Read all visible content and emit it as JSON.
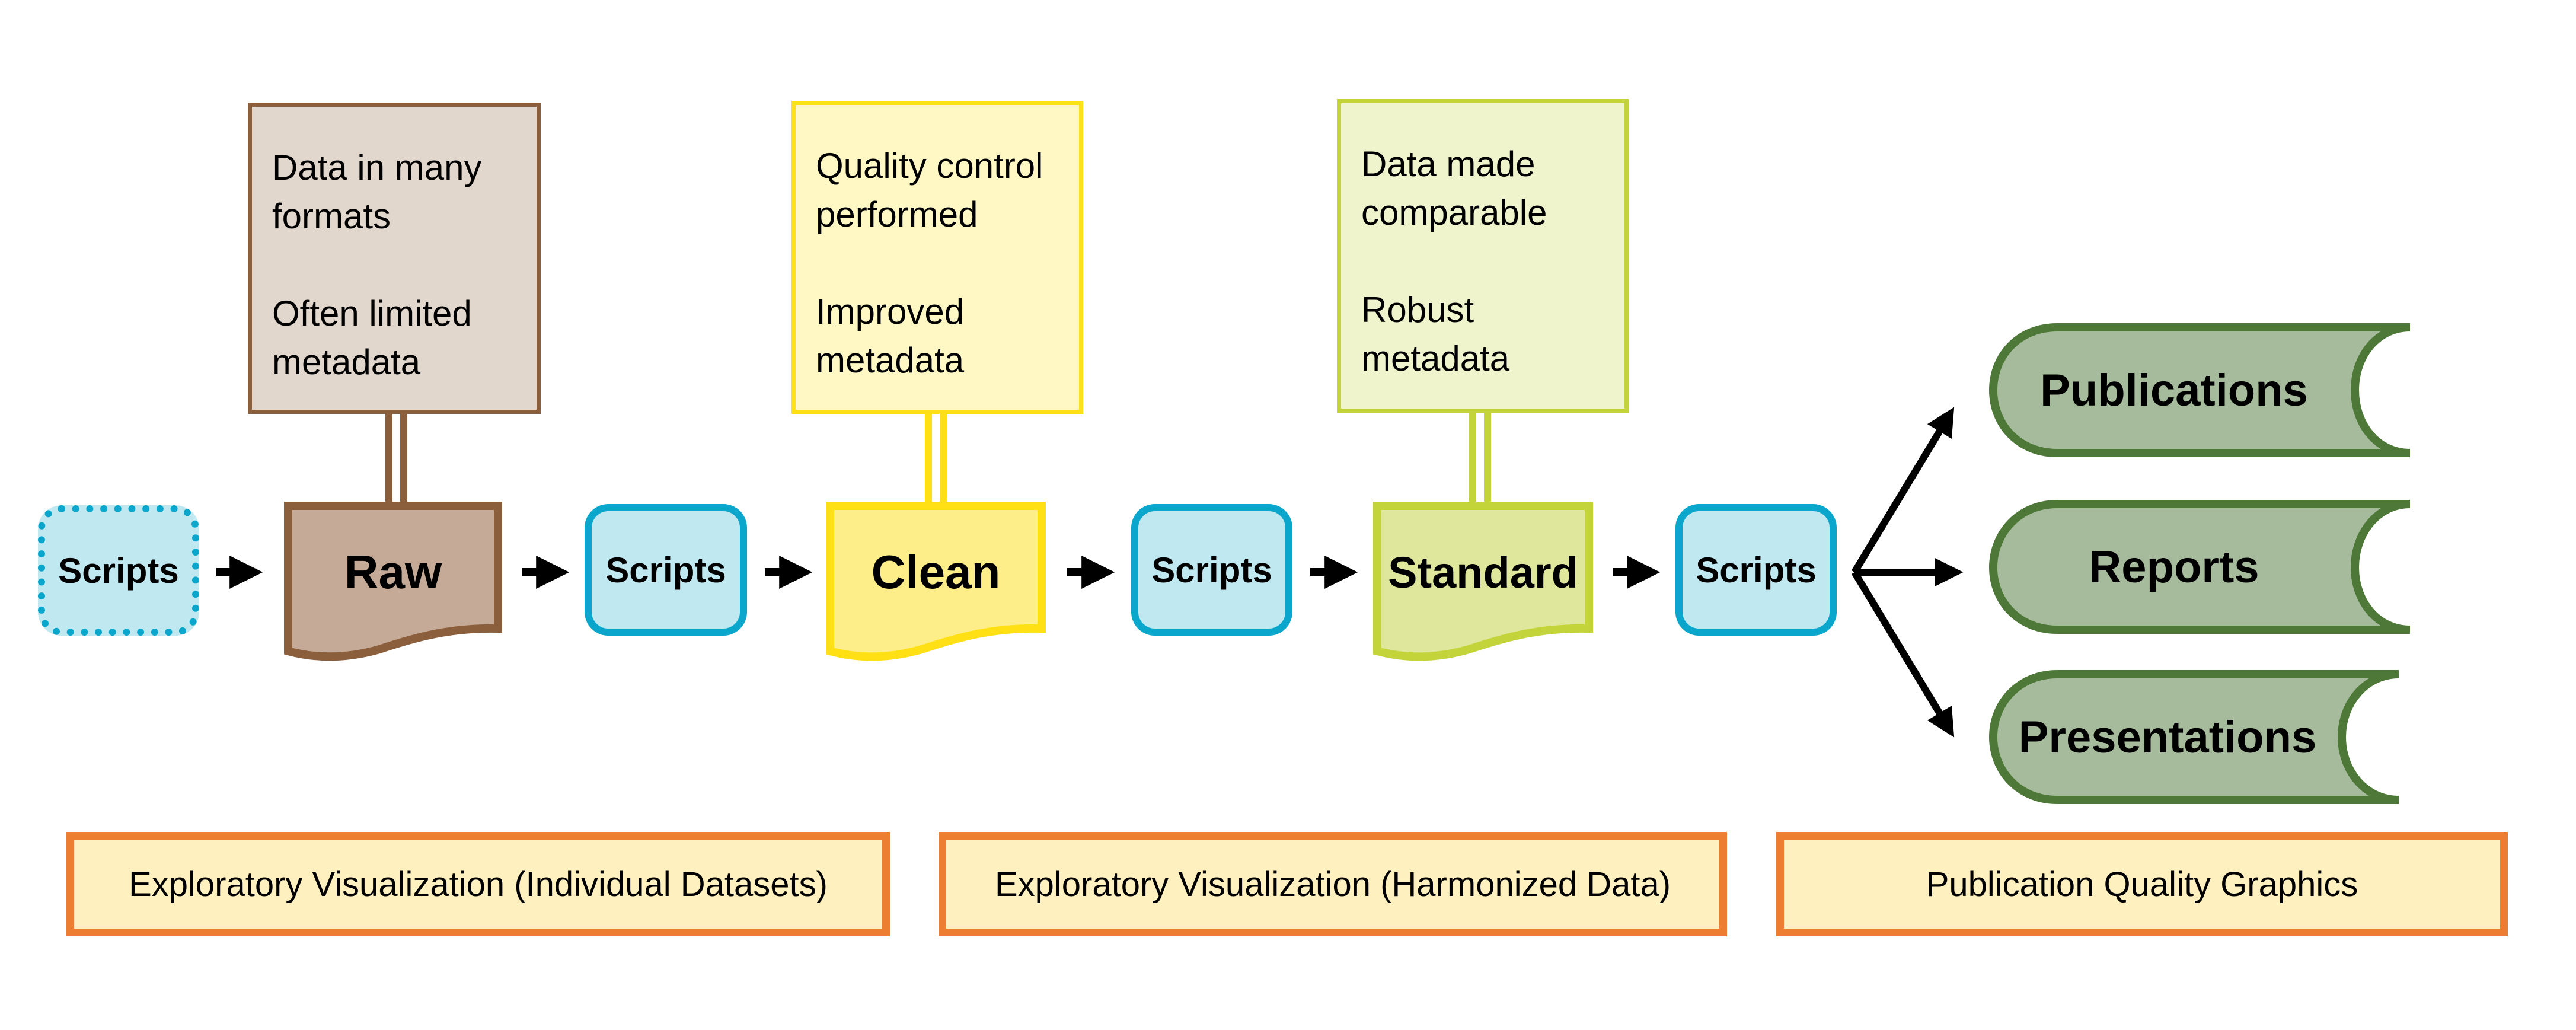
{
  "pipeline": {
    "scripts_label": "Scripts",
    "stages": [
      {
        "label": "Raw",
        "note_line1a": "Data in many",
        "note_line1b": "formats",
        "note_line2a": "Often limited",
        "note_line2b": "metadata",
        "border_color": "#8b5e3c",
        "note_fill": "#e1d7cd",
        "doc_fill": "#c4aa97"
      },
      {
        "label": "Clean",
        "note_line1a": "Quality control",
        "note_line1b": "performed",
        "note_line2a": "Improved",
        "note_line2b": "metadata",
        "border_color": "#ffe015",
        "note_fill": "#fff8c5",
        "doc_fill": "#fdee8a"
      },
      {
        "label": "Standard",
        "note_line1a": "Data made",
        "note_line1b": "comparable",
        "note_line2a": "Robust",
        "note_line2b": "metadata",
        "border_color": "#c3d43a",
        "note_fill": "#eff4cd",
        "doc_fill": "#dfe79d"
      }
    ]
  },
  "outputs": [
    {
      "label": "Publications"
    },
    {
      "label": "Reports"
    },
    {
      "label": "Presentations"
    }
  ],
  "output_colors": {
    "fill": "#a6bb9b",
    "border": "#4e7838"
  },
  "scripts_colors": {
    "fill": "#c0e8f0",
    "border": "#0aa6cb"
  },
  "phases": [
    {
      "label": "Exploratory Visualization (Individual Datasets)"
    },
    {
      "label": "Exploratory Visualization (Harmonized Data)"
    },
    {
      "label": "Publication Quality Graphics"
    }
  ],
  "phase_colors": {
    "fill": "#fff0c0",
    "border": "#ed7d31"
  }
}
